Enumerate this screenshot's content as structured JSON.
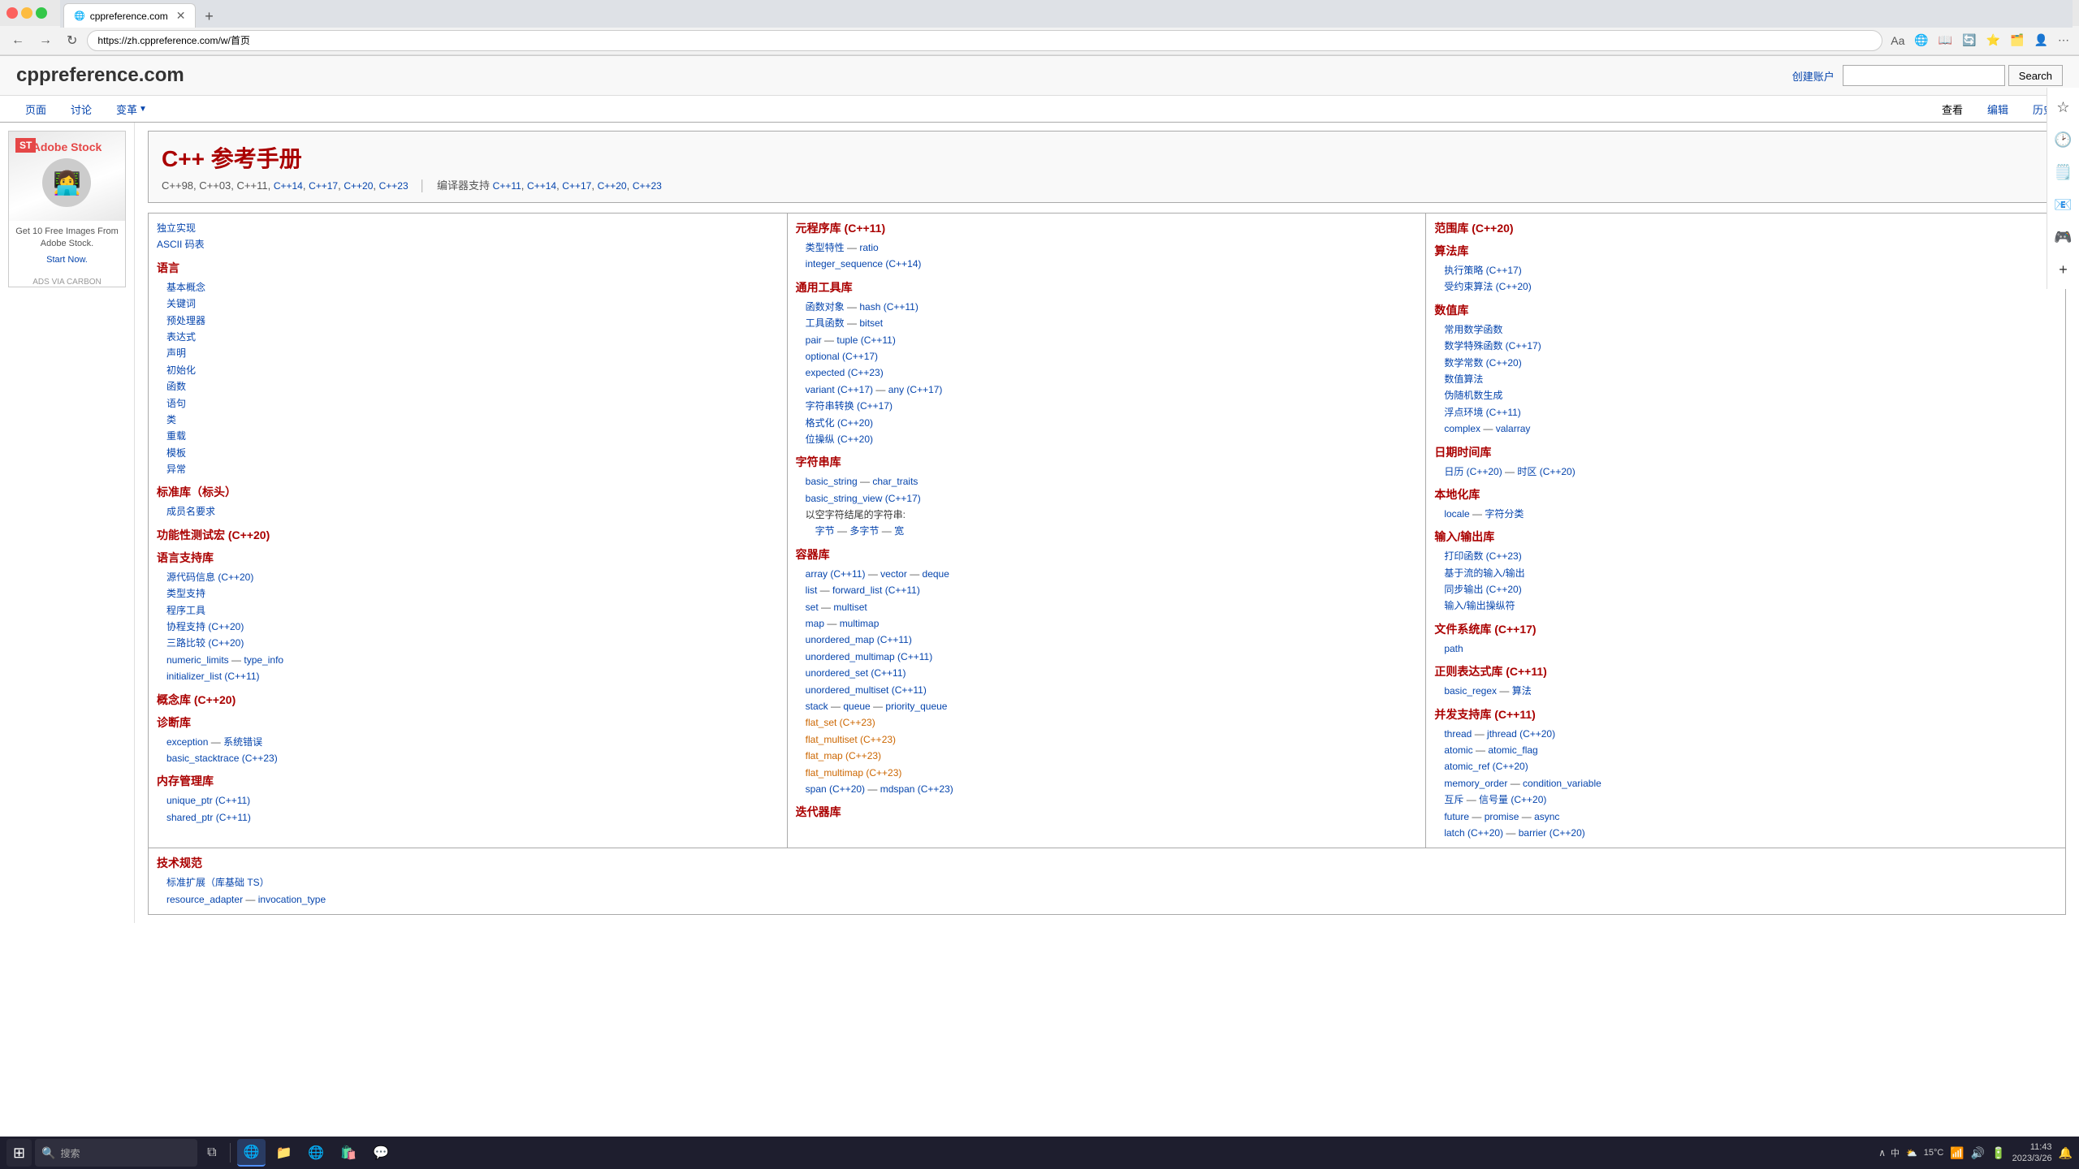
{
  "browser": {
    "tab_title": "cppreference.com",
    "tab_url": "zh.cppreference.com",
    "address": "https://zh.cppreference.com/w/首页",
    "nav_buttons": [
      "←",
      "→",
      "↻"
    ],
    "nav_icons": [
      "🔎",
      "⭐",
      "📋",
      "🔄",
      "⭐",
      "👤",
      "⋯"
    ]
  },
  "sidebar_icons": [
    "🔍",
    "🏠",
    "🔖",
    "📝",
    "🗂️"
  ],
  "header": {
    "site_title": "cppreference.com",
    "create_account": "创建账户",
    "search_placeholder": "",
    "search_button": "Search"
  },
  "wiki_tabs": [
    {
      "label": "页面",
      "active": false
    },
    {
      "label": "讨论",
      "active": false
    },
    {
      "label": "变革",
      "active": false,
      "has_dropdown": true
    }
  ],
  "wiki_actions": [
    "查看",
    "编辑",
    "历史"
  ],
  "ad": {
    "brand": "Adobe Stock",
    "headline": "Get 10 Free Images From Adobe Stock.",
    "cta": "Start Now.",
    "via": "ADS VIA CARBON"
  },
  "cpp_title": "C++ 参考手册",
  "cpp_versions_text": "C++98, C++03, C++11,",
  "cpp_versions_links": [
    "C++14",
    "C++17",
    "C++20",
    "C++23"
  ],
  "cpp_compiler_label": "编译器支持",
  "cpp_compiler_links": [
    "C++11",
    "C++14",
    "C++17",
    "C++20",
    "C++23"
  ],
  "sections": {
    "left": {
      "items": [
        {
          "type": "link",
          "text": "独立实现",
          "color": "blue"
        },
        {
          "type": "link",
          "text": "ASCII 码表",
          "color": "blue"
        },
        {
          "type": "heading",
          "text": "语言"
        },
        {
          "type": "link",
          "text": "基本概念"
        },
        {
          "type": "link",
          "text": "关键词"
        },
        {
          "type": "link",
          "text": "预处理器"
        },
        {
          "type": "link",
          "text": "表达式"
        },
        {
          "type": "link",
          "text": "声明"
        },
        {
          "type": "link",
          "text": "初始化"
        },
        {
          "type": "link",
          "text": "函数"
        },
        {
          "type": "link",
          "text": "语句"
        },
        {
          "type": "link",
          "text": "类"
        },
        {
          "type": "link",
          "text": "重载"
        },
        {
          "type": "link",
          "text": "模板"
        },
        {
          "type": "link",
          "text": "异常"
        },
        {
          "type": "heading",
          "text": "标准库（标头）"
        },
        {
          "type": "link",
          "text": "成员名要求"
        },
        {
          "type": "heading",
          "text": "功能性测试宏 (C++20)"
        },
        {
          "type": "heading",
          "text": "语言支持库"
        },
        {
          "type": "link",
          "text": "源代码信息 (C++20)"
        },
        {
          "type": "link",
          "text": "类型支持"
        },
        {
          "type": "link",
          "text": "程序工具"
        },
        {
          "type": "link",
          "text": "协程支持 (C++20)"
        },
        {
          "type": "link",
          "text": "三路比较 (C++20)"
        },
        {
          "type": "link",
          "text": "numeric_limits"
        },
        {
          "type": "sep",
          "text": "—"
        },
        {
          "type": "link",
          "text": "type_info"
        },
        {
          "type": "link",
          "text": "initializer_list (C++11)"
        },
        {
          "type": "heading",
          "text": "概念库 (C++20)"
        },
        {
          "type": "heading",
          "text": "诊断库"
        },
        {
          "type": "link",
          "text": "exception"
        },
        {
          "type": "sep",
          "text": "—"
        },
        {
          "type": "link",
          "text": "系统错误"
        },
        {
          "type": "link",
          "text": "basic_stacktrace (C++23)"
        },
        {
          "type": "heading",
          "text": "内存管理库"
        },
        {
          "type": "link",
          "text": "unique_ptr (C++11)"
        },
        {
          "type": "link",
          "text": "shared_ptr (C++11)"
        }
      ]
    },
    "middle": {
      "items": [
        {
          "type": "heading",
          "text": "元程序库 (C++11)"
        },
        {
          "type": "link",
          "text": "类型特性"
        },
        {
          "type": "sep",
          "text": "—"
        },
        {
          "type": "link",
          "text": "ratio"
        },
        {
          "type": "link",
          "text": "integer_sequence (C++14)"
        },
        {
          "type": "heading",
          "text": "通用工具库"
        },
        {
          "type": "link",
          "text": "函数对象"
        },
        {
          "type": "sep",
          "text": "—"
        },
        {
          "type": "link",
          "text": "hash (C++11)"
        },
        {
          "type": "link",
          "text": "工具函数"
        },
        {
          "type": "sep",
          "text": "—"
        },
        {
          "type": "link",
          "text": "bitset"
        },
        {
          "type": "link",
          "text": "pair"
        },
        {
          "type": "sep",
          "text": "—"
        },
        {
          "type": "link",
          "text": "tuple (C++11)"
        },
        {
          "type": "link",
          "text": "optional (C++17)"
        },
        {
          "type": "link",
          "text": "expected (C++23)"
        },
        {
          "type": "link",
          "text": "variant (C++17)"
        },
        {
          "type": "sep",
          "text": "—"
        },
        {
          "type": "link",
          "text": "any (C++17)"
        },
        {
          "type": "link",
          "text": "字符串转换 (C++17)"
        },
        {
          "type": "link",
          "text": "格式化 (C++20)"
        },
        {
          "type": "link",
          "text": "位操纵 (C++20)"
        },
        {
          "type": "heading",
          "text": "字符串库"
        },
        {
          "type": "link",
          "text": "basic_string"
        },
        {
          "type": "sep",
          "text": "—"
        },
        {
          "type": "link",
          "text": "char_traits"
        },
        {
          "type": "link",
          "text": "basic_string_view (C++17)"
        },
        {
          "type": "text",
          "text": "以空字符结尾的字符串:"
        },
        {
          "type": "indent_links",
          "items": [
            "字节",
            "多字节",
            "宽"
          ]
        },
        {
          "type": "heading",
          "text": "容器库"
        },
        {
          "type": "link",
          "text": "array (C++11)"
        },
        {
          "type": "sep",
          "text": "—"
        },
        {
          "type": "link",
          "text": "vector"
        },
        {
          "type": "sep",
          "text": "—"
        },
        {
          "type": "link",
          "text": "deque"
        },
        {
          "type": "link",
          "text": "list"
        },
        {
          "type": "sep",
          "text": "—"
        },
        {
          "type": "link",
          "text": "forward_list (C++11)"
        },
        {
          "type": "link",
          "text": "set"
        },
        {
          "type": "sep",
          "text": "—"
        },
        {
          "type": "link",
          "text": "multiset"
        },
        {
          "type": "link",
          "text": "map"
        },
        {
          "type": "sep",
          "text": "—"
        },
        {
          "type": "link",
          "text": "multimap"
        },
        {
          "type": "link",
          "text": "unordered_map (C++11)"
        },
        {
          "type": "link",
          "text": "unordered_multimap (C++11)"
        },
        {
          "type": "link",
          "text": "unordered_set (C++11)"
        },
        {
          "type": "link",
          "text": "unordered_multiset (C++11)"
        },
        {
          "type": "link",
          "text": "stack"
        },
        {
          "type": "sep",
          "text": "—"
        },
        {
          "type": "link",
          "text": "queue"
        },
        {
          "type": "sep",
          "text": "—"
        },
        {
          "type": "link",
          "text": "priority_queue"
        },
        {
          "type": "orange_link",
          "text": "flat_set (C++23)"
        },
        {
          "type": "orange_link",
          "text": "flat_multiset (C++23)"
        },
        {
          "type": "orange_link",
          "text": "flat_map (C++23)"
        },
        {
          "type": "orange_link",
          "text": "flat_multimap (C++23)"
        },
        {
          "type": "link",
          "text": "span (C++20)"
        },
        {
          "type": "sep",
          "text": "—"
        },
        {
          "type": "link",
          "text": "mdspan (C++23)"
        },
        {
          "type": "heading",
          "text": "迭代器库"
        }
      ]
    },
    "right": {
      "items": [
        {
          "type": "heading",
          "text": "范围库 (C++20)"
        },
        {
          "type": "heading_sub",
          "text": "算法库"
        },
        {
          "type": "link",
          "text": "执行策略 (C++17)"
        },
        {
          "type": "link",
          "text": "受约束算法 (C++20)"
        },
        {
          "type": "heading",
          "text": "数值库"
        },
        {
          "type": "link",
          "text": "常用数学函数"
        },
        {
          "type": "link",
          "text": "数学特殊函数 (C++17)"
        },
        {
          "type": "link",
          "text": "数学常数 (C++20)"
        },
        {
          "type": "link",
          "text": "数值算法"
        },
        {
          "type": "link",
          "text": "伪随机数生成"
        },
        {
          "type": "link",
          "text": "浮点环境 (C++11)"
        },
        {
          "type": "link",
          "text": "complex"
        },
        {
          "type": "sep",
          "text": "—"
        },
        {
          "type": "link",
          "text": "valarray"
        },
        {
          "type": "heading",
          "text": "日期时间库"
        },
        {
          "type": "link",
          "text": "日历 (C++20)"
        },
        {
          "type": "sep",
          "text": "—"
        },
        {
          "type": "link",
          "text": "时区 (C++20)"
        },
        {
          "type": "heading",
          "text": "本地化库"
        },
        {
          "type": "link",
          "text": "locale"
        },
        {
          "type": "sep",
          "text": "—"
        },
        {
          "type": "link",
          "text": "字符分类"
        },
        {
          "type": "heading",
          "text": "输入/输出库"
        },
        {
          "type": "link",
          "text": "打印函数 (C++23)"
        },
        {
          "type": "link",
          "text": "基于流的输入/输出"
        },
        {
          "type": "link",
          "text": "同步输出 (C++20)"
        },
        {
          "type": "link",
          "text": "输入/输出操纵符"
        },
        {
          "type": "heading",
          "text": "文件系统库 (C++17)"
        },
        {
          "type": "link",
          "text": "path"
        },
        {
          "type": "heading",
          "text": "正则表达式库 (C++11)"
        },
        {
          "type": "link",
          "text": "basic_regex"
        },
        {
          "type": "sep",
          "text": "—"
        },
        {
          "type": "link",
          "text": "算法"
        },
        {
          "type": "heading",
          "text": "并发支持库 (C++11)"
        },
        {
          "type": "link",
          "text": "thread"
        },
        {
          "type": "sep",
          "text": "—"
        },
        {
          "type": "link",
          "text": "jthread (C++20)"
        },
        {
          "type": "link",
          "text": "atomic"
        },
        {
          "type": "sep",
          "text": "—"
        },
        {
          "type": "link",
          "text": "atomic_flag"
        },
        {
          "type": "link",
          "text": "atomic_ref (C++20)"
        },
        {
          "type": "link",
          "text": "memory_order"
        },
        {
          "type": "sep",
          "text": "—"
        },
        {
          "type": "link",
          "text": "condition_variable"
        },
        {
          "type": "link",
          "text": "互斥"
        },
        {
          "type": "sep",
          "text": "—"
        },
        {
          "type": "link",
          "text": "信号量 (C++20)"
        },
        {
          "type": "link",
          "text": "future"
        },
        {
          "type": "sep",
          "text": "—"
        },
        {
          "type": "link",
          "text": "promise"
        },
        {
          "type": "sep",
          "text": "—"
        },
        {
          "type": "link",
          "text": "async"
        },
        {
          "type": "link",
          "text": "latch (C++20)"
        },
        {
          "type": "sep",
          "text": "—"
        },
        {
          "type": "link",
          "text": "barrier (C++20)"
        }
      ]
    }
  },
  "tech_spec": {
    "title": "技术规范",
    "subtitle": "标准扩展（库基础 TS）",
    "items": [
      "resource_adapter",
      "invocation_type"
    ]
  },
  "taskbar": {
    "start_icon": "⊞",
    "search_placeholder": "搜索",
    "pinned_apps": [
      "🌐",
      "📁",
      "🌐",
      "💬"
    ],
    "time": "11:43",
    "date": "2023/3/26",
    "temperature": "15°C",
    "weather": "⛅",
    "battery_icon": "🔋",
    "volume_icon": "🔊",
    "network_icon": "📶",
    "lang": "中"
  },
  "status_bar": {
    "right_label": "15°C  ∧",
    "time": "11:43",
    "date": "2023/3/26"
  }
}
